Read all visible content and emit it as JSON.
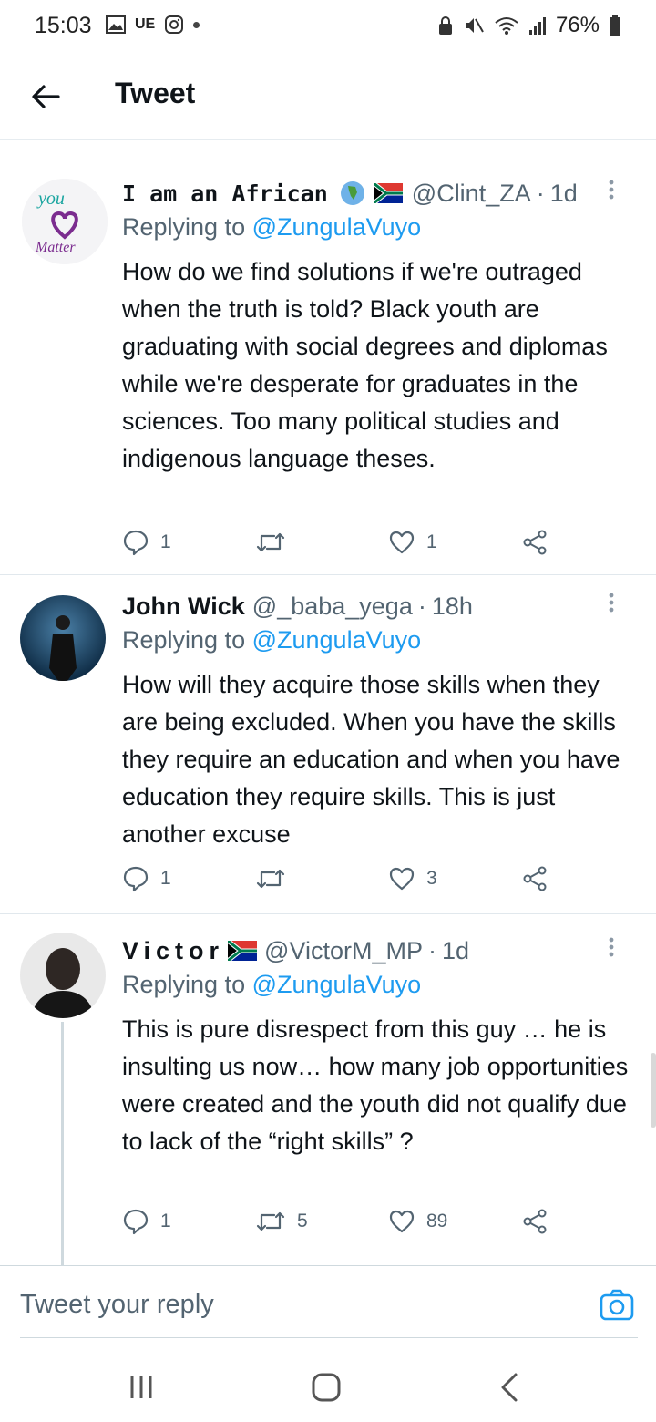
{
  "status_bar": {
    "time": "15:03",
    "carrier": "UE",
    "battery": "76%"
  },
  "header": {
    "title": "Tweet"
  },
  "tweets": [
    {
      "display_name": "I am an African",
      "handle": "@Clint_ZA",
      "separator": "·",
      "time": "1d",
      "replying_label": "Replying to",
      "replying_to": "@ZungulaVuyo",
      "text": "How do we find solutions if we're outraged when the truth is told? Black youth are graduating with social degrees and diplomas while we're desperate for graduates in the sciences. Too many political studies and indigenous language theses.",
      "avatar_text_top": "you",
      "avatar_text_bottom": "Matter",
      "replies": "1",
      "retweets": "",
      "likes": "1"
    },
    {
      "display_name": "John Wick",
      "handle": "@_baba_yega",
      "separator": "·",
      "time": "18h",
      "replying_label": "Replying to",
      "replying_to": "@ZungulaVuyo",
      "text": "How will they acquire those skills when they are being excluded. When you have the skills they require an education and when you have education they require skills. This is just another excuse",
      "replies": "1",
      "retweets": "",
      "likes": "3"
    },
    {
      "display_name": "Victor",
      "handle": "@VictorM_MP",
      "separator": "·",
      "time": "1d",
      "replying_label": "Replying to",
      "replying_to": "@ZungulaVuyo",
      "text": "This is pure disrespect from this guy … he is insulting us now… how many job opportunities were created and the youth did not qualify due to lack of the “right skills” ?",
      "replies": "1",
      "retweets": "5",
      "likes": "89"
    }
  ],
  "reply_bar": {
    "placeholder": "Tweet your reply"
  },
  "colors": {
    "link_blue": "#1d9bf0",
    "secondary_text": "#536471",
    "divider": "#e1e8ed"
  }
}
